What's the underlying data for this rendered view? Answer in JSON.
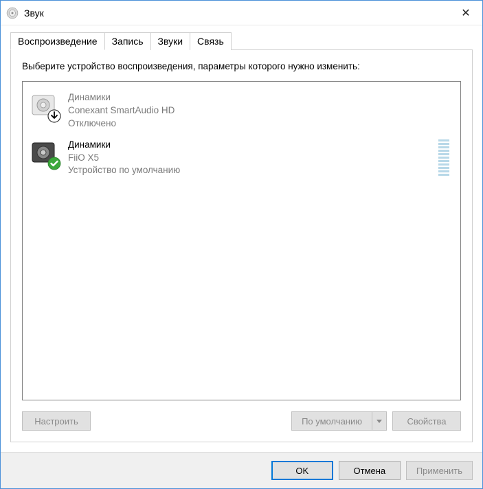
{
  "window": {
    "title": "Звук"
  },
  "tabs": [
    {
      "label": "Воспроизведение",
      "active": true
    },
    {
      "label": "Запись",
      "active": false
    },
    {
      "label": "Звуки",
      "active": false
    },
    {
      "label": "Связь",
      "active": false
    }
  ],
  "playback": {
    "instruction": "Выберите устройство воспроизведения, параметры которого нужно изменить:",
    "devices": [
      {
        "name": "Динамики",
        "driver": "Conexant SmartAudio HD",
        "status": "Отключено",
        "state": "disabled",
        "has_level": false
      },
      {
        "name": "Динамики",
        "driver": "FiiO X5",
        "status": "Устройство по умолчанию",
        "state": "default",
        "has_level": true
      }
    ],
    "buttons": {
      "configure": "Настроить",
      "set_default": "По умолчанию",
      "properties": "Свойства"
    }
  },
  "dialog_buttons": {
    "ok": "OK",
    "cancel": "Отмена",
    "apply": "Применить"
  }
}
